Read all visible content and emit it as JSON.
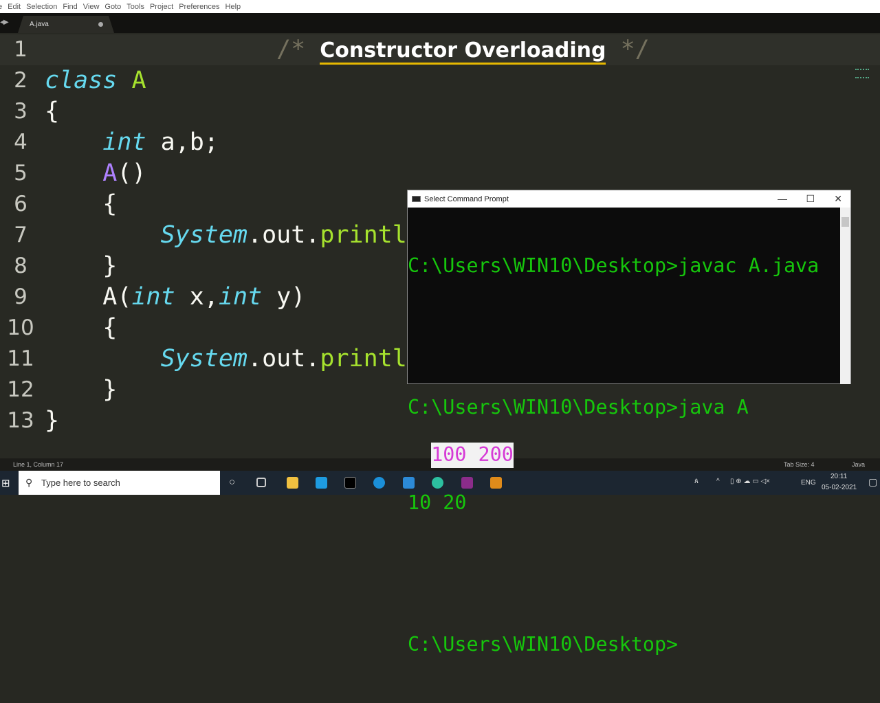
{
  "menu": [
    "e",
    "Edit",
    "Selection",
    "Find",
    "View",
    "Goto",
    "Tools",
    "Project",
    "Preferences",
    "Help"
  ],
  "tab": {
    "name": "A.java"
  },
  "editor": {
    "line_numbers": [
      "1",
      "2",
      "3",
      "4",
      "5",
      "6",
      "7",
      "8",
      "9",
      "10",
      "11",
      "12",
      "13"
    ],
    "comment_open": "/*",
    "title": "Constructor Overloading",
    "comment_close": "*/",
    "l2": [
      "class",
      " ",
      "A"
    ],
    "l3": "{",
    "l4": [
      "    ",
      "int",
      " a,b;"
    ],
    "l5": [
      "    ",
      "A",
      "()"
    ],
    "l6": "    {",
    "l7": [
      "        ",
      "System",
      ".out.",
      "printl"
    ],
    "l8": "    }",
    "l9": [
      "    A(",
      "int",
      " x,",
      "int",
      " y)"
    ],
    "l10": "    {",
    "l11": [
      "        ",
      "System",
      ".out.",
      "printl"
    ],
    "l12": "    }",
    "l13": "}"
  },
  "cmd": {
    "title": "Select Command Prompt",
    "lines": [
      "C:\\Users\\WIN10\\Desktop>javac A.java",
      "",
      "C:\\Users\\WIN10\\Desktop>java A",
      "100 200",
      "10 20",
      "",
      "C:\\Users\\WIN10\\Desktop>"
    ],
    "minimize": "—",
    "maximize": "☐",
    "close": "✕"
  },
  "status": {
    "position": "Line 1, Column 17",
    "tab_size": "Tab Size: 4",
    "syntax": "Java"
  },
  "taskbar": {
    "search_placeholder": "Type here to search",
    "lang": "ENG",
    "time": "20:11",
    "date": "05-02-2021"
  }
}
